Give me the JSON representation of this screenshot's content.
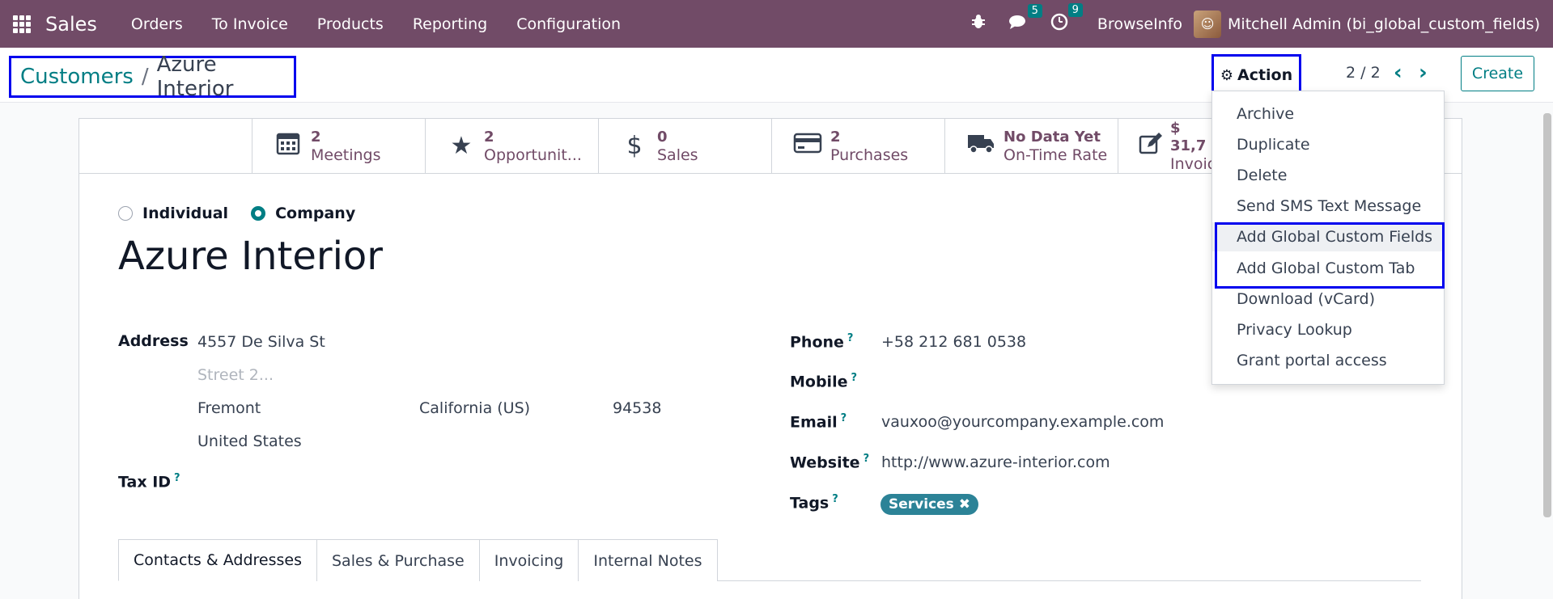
{
  "navbar": {
    "app_name": "Sales",
    "menu": [
      "Orders",
      "To Invoice",
      "Products",
      "Reporting",
      "Configuration"
    ],
    "messages_count": "5",
    "activities_count": "9",
    "company_name": "BrowseInfo",
    "user_name": "Mitchell Admin (bi_global_custom_fields)",
    "background_color": "#714b67"
  },
  "control": {
    "breadcrumb_parent": "Customers",
    "breadcrumb_separator": "/",
    "breadcrumb_current": "Azure Interior",
    "action_label": "Action",
    "pager": "2 / 2",
    "create_label": "Create"
  },
  "smart_buttons": [
    {
      "value": "2",
      "label": "Meetings",
      "icon": "calendar-icon"
    },
    {
      "value": "2",
      "label": "Opportunit...",
      "icon": "star-icon"
    },
    {
      "value": "0",
      "label": "Sales",
      "icon": "dollar-icon"
    },
    {
      "value": "2",
      "label": "Purchases",
      "icon": "credit-card-icon"
    },
    {
      "value": "No Data Yet",
      "label": "On-Time Rate",
      "icon": "truck-icon"
    },
    {
      "value": "$ 31,7",
      "label": "Invoic",
      "icon": "pencil-square-icon"
    }
  ],
  "form": {
    "type_individual": "Individual",
    "type_company": "Company",
    "name": "Azure Interior",
    "address_label": "Address",
    "street": "4557 De Silva St",
    "street2_placeholder": "Street 2...",
    "city": "Fremont",
    "state": "California (US)",
    "zip": "94538",
    "country": "United States",
    "tax_id_label": "Tax ID",
    "phone_label": "Phone",
    "phone": "+58 212 681 0538",
    "mobile_label": "Mobile",
    "email_label": "Email",
    "email": "vauxoo@yourcompany.example.com",
    "website_label": "Website",
    "website": "http://www.azure-interior.com",
    "tags_label": "Tags",
    "tag": "Services",
    "help_mark": "?"
  },
  "tabs": [
    "Contacts & Addresses",
    "Sales & Purchase",
    "Invoicing",
    "Internal Notes"
  ],
  "action_menu": [
    "Archive",
    "Duplicate",
    "Delete",
    "Send SMS Text Message",
    "Add Global Custom Fields",
    "Add Global Custom Tab",
    "Download (vCard)",
    "Privacy Lookup",
    "Grant portal access"
  ],
  "colors": {
    "accent": "#017e84",
    "highlight_box": "#0000ee",
    "tag": "#2c8397"
  }
}
